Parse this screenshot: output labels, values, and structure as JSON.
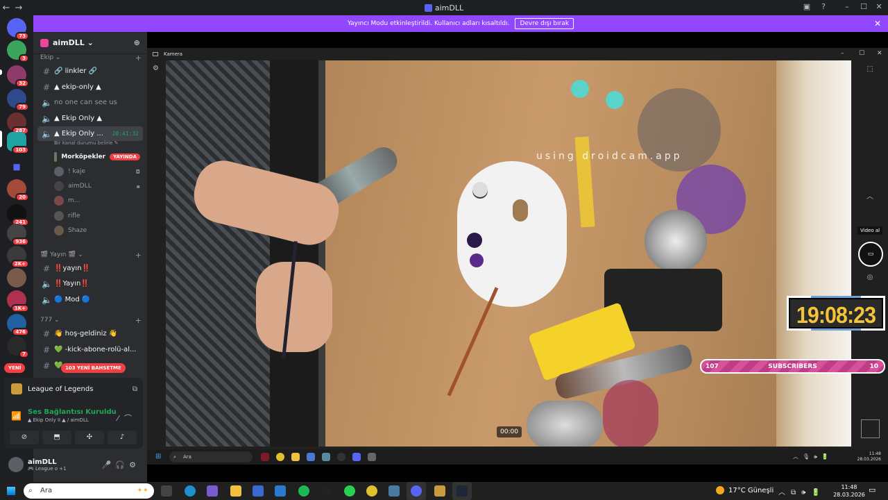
{
  "window": {
    "title": "aimDLL"
  },
  "banner": {
    "text": "Yayıncı Modu etkinleştirildi. Kullanıcı adları kısaltıldı.",
    "button": "Devre dışı bırak"
  },
  "servers": {
    "badges": [
      "73",
      "3",
      "32",
      "79",
      "287",
      "103",
      "20",
      "241",
      "936",
      "2K+",
      "1K+",
      "476",
      "7"
    ],
    "new_label": "YENİ"
  },
  "guild": {
    "name": "aimDLL"
  },
  "categories": {
    "ekip": "Ekip",
    "yayin": "🎬 Yayın 🎬",
    "seven": "777"
  },
  "channels": {
    "linkler": "🔗 linkler 🔗",
    "ekip_only": "▲ ekip-only ▲",
    "no_one": "no one can see us",
    "ekip_only_voice": "▲ Ekip Only ▲",
    "ekip_only_sel": "▲ Ekip Only ...",
    "timer": "20:41:32",
    "status": "Bir kanal durumu belirle",
    "yayin1": "‼️yayın‼️",
    "yayin2": "‼️Yayın‼️",
    "mod": "🔵 Mod 🔵",
    "hos": "👋 hoş-geldiniz 👋",
    "kick": "💚 -kick-abone-rolü-al...",
    "last": "💚"
  },
  "voice_users": [
    {
      "name": "Morköpekler",
      "live": "YAYINDA"
    },
    {
      "name": "! kaje"
    },
    {
      "name": "aimDLL"
    },
    {
      "name": "m..."
    },
    {
      "name": "rifle"
    },
    {
      "name": "Shaze"
    }
  ],
  "new_mentions": "103 YENİ BAHSETME",
  "activity": {
    "game": "League of Legends"
  },
  "voice": {
    "status": "Ses Bağlantısı Kuruldu",
    "channel": "▲ Ekip Only II ▲ / aimDLL"
  },
  "user": {
    "name": "aimDLL",
    "status": "🎮 League o +1"
  },
  "camera": {
    "title": "Kamera",
    "watermark": "using droidcam.app",
    "time": "00:00",
    "video_label": "Video al"
  },
  "overlay": {
    "clock": "19:08:23",
    "subs_left": "107",
    "subs_label": "SUBSCRIBERS",
    "subs_right": "10"
  },
  "inner_taskbar": {
    "search": "Ara",
    "time": "11:48",
    "date": "28.03.2026"
  },
  "taskbar": {
    "search": "Ara",
    "weather": "17°C  Güneşli",
    "time": "11:48",
    "date": "28.03.2026"
  },
  "colors": {
    "discord_bg": "#2b2d31",
    "banner": "#9146ff",
    "clock_text": "#f3c33a",
    "subs_bar": "#d6539b"
  }
}
